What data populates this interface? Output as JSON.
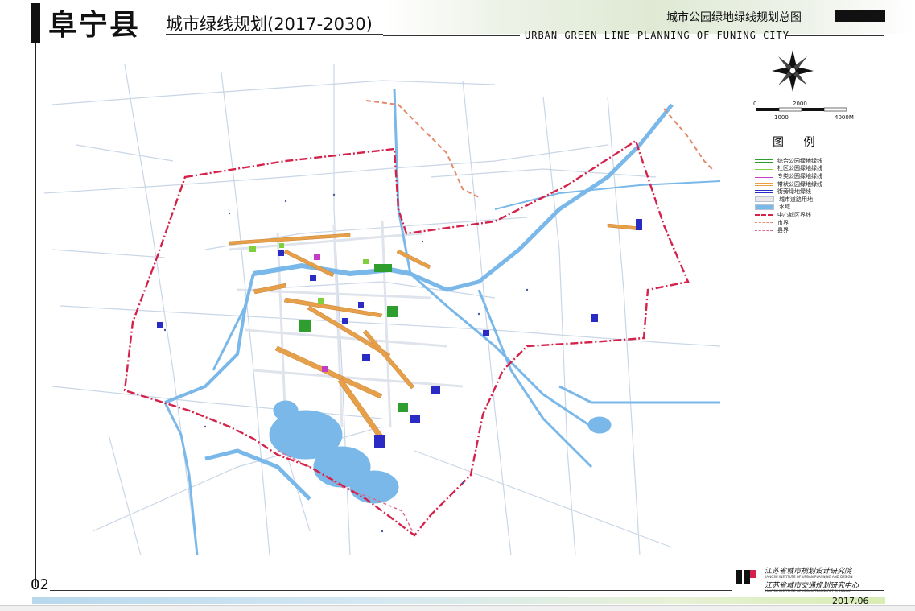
{
  "header": {
    "city": "阜宁县",
    "plan_title": "城市绿线规划(2017-2030)",
    "sheet_title": "城市公园绿地绿线规划总图",
    "english_title": "URBAN GREEN LINE PLANNING OF FUNING CITY"
  },
  "scale_bar": {
    "labels_top": [
      "0",
      "2000"
    ],
    "labels_bottom": [
      "1000",
      "4000M"
    ]
  },
  "legend": {
    "title": "图 例",
    "items": [
      {
        "label": "综合公园绿地绿线",
        "color": "#2e9e2e",
        "style": "double-line"
      },
      {
        "label": "社区公园绿地绿线",
        "color": "#7fcf3f",
        "style": "double-line"
      },
      {
        "label": "专类公园绿地绿线",
        "color": "#c43cc4",
        "style": "double-line"
      },
      {
        "label": "带状公园绿地绿线",
        "color": "#e7a04a",
        "style": "double-line"
      },
      {
        "label": "街旁绿地绿线",
        "color": "#2a2ac4",
        "style": "double-line"
      },
      {
        "label": "城市道路用地",
        "color": "#e9e9ec",
        "style": "fill"
      },
      {
        "label": "水域",
        "color": "#7ab8ea",
        "style": "fill"
      },
      {
        "label": "中心城区界线",
        "color": "#d4224a",
        "style": "dash-dot"
      },
      {
        "label": "市界",
        "color": "#e28a6a",
        "style": "dashed"
      },
      {
        "label": "县界",
        "color": "#d96a8a",
        "style": "dashed"
      }
    ]
  },
  "institutes": {
    "name_1": "江苏省城市规划设计研究院",
    "name_1_en": "JIANGSU INSTITUTE OF URBAN PLANNING AND DESIGN",
    "name_2": "江苏省城市交通规划研究中心",
    "name_2_en": "JIANGSU INSTITUTE OF URBAN TRANSPORT PLANNING"
  },
  "footer": {
    "page_number": "02",
    "date": "2017.06"
  },
  "colors": {
    "water": "#7ab8ea",
    "road": "#c9d6e6",
    "boundary": "#d4224a",
    "green_main": "#2e9e2e",
    "strip_park": "#e7a04a",
    "street_green": "#2a2ac4"
  }
}
